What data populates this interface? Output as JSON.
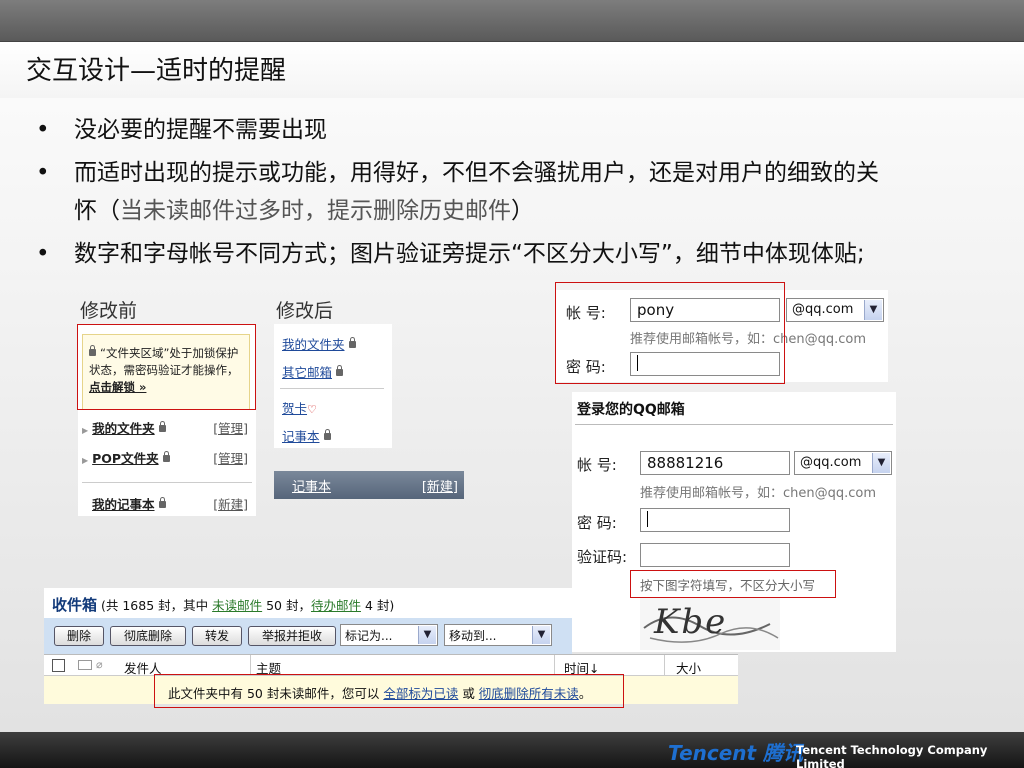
{
  "slide": {
    "title": "交互设计—适时的提醒",
    "bullets": [
      "没必要的提醒不需要出现",
      "而适时出现的提示或功能，用得好，不但不会骚扰用户，还是对用户的细致的关",
      "数字和字母帐号不同方式；图片验证旁提示“不区分大小写”，细节中体现体贴;"
    ],
    "bullet2_line2_a": "怀（",
    "bullet2_line2_b": "当未读邮件过多时，提示删除历史邮件",
    "bullet2_line2_c": "）"
  },
  "before": {
    "label": "修改前",
    "notice_text": "“文件夹区域”处于加锁保护状态，需密码验证才能操作，",
    "notice_link": "点击解锁 »",
    "items": [
      {
        "label": "我的文件夹",
        "action": "[管理]"
      },
      {
        "label": "POP文件夹",
        "action": "[管理]"
      },
      {
        "label": "我的记事本",
        "action": "[新建]"
      }
    ]
  },
  "after": {
    "label": "修改后",
    "links": [
      "我的文件夹",
      "其它邮箱",
      "贺卡",
      "记事本"
    ],
    "heart": "♡",
    "bar_label": "记事本",
    "bar_action": "[新建]"
  },
  "login_small": {
    "account_label": "帐  号:",
    "account_value": "pony",
    "domain": "@qq.com",
    "hint": "推荐使用邮箱帐号，如：chen@qq.com",
    "password_label": "密  码:"
  },
  "login_big": {
    "title": "登录您的QQ邮箱",
    "account_label": "帐  号:",
    "account_value": "88881216",
    "domain": "@qq.com",
    "hint": "推荐使用邮箱帐号，如：chen@qq.com",
    "password_label": "密  码:",
    "captcha_label": "验证码:",
    "captcha_hint": "按下图字符填写，不区分大小写",
    "captcha_text": "Kbe"
  },
  "inbox": {
    "title": "收件箱",
    "summary_a": "(共 1685 封，其中 ",
    "unread_link": "未读邮件",
    "summary_b": " 50 封，",
    "todo_link": "待办邮件",
    "summary_c": " 4 封)",
    "buttons": [
      "删除",
      "彻底删除",
      "转发",
      "举报并拒收"
    ],
    "mark_select": "标记为...",
    "move_select": "移动到...",
    "columns": [
      "发件人",
      "主题",
      "时间↓",
      "大小"
    ],
    "notice_a": "此文件夹中有  50 封未读邮件，您可以 ",
    "notice_link1": "全部标为已读",
    "notice_b": " 或 ",
    "notice_link2": "彻底删除所有未读",
    "notice_c": "。"
  },
  "footer": {
    "logo": "Tencent 腾讯",
    "company": "Tencent Technology Company Limited"
  }
}
